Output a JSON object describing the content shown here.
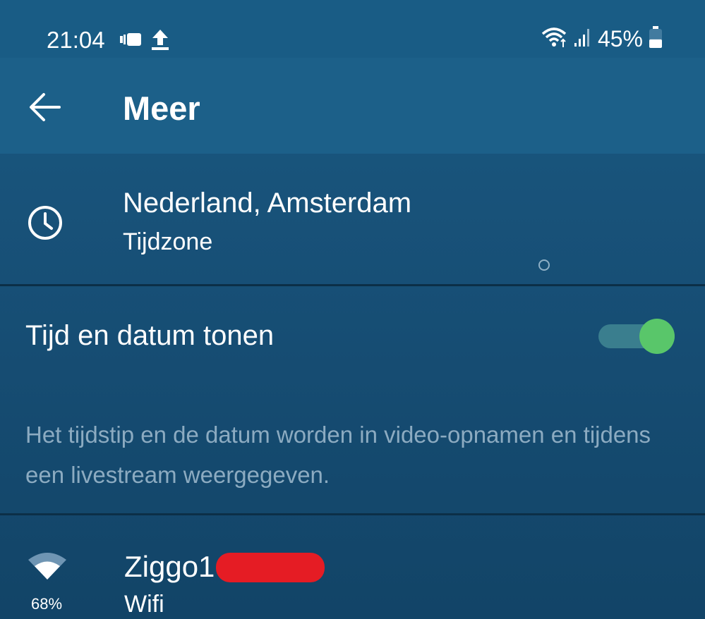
{
  "status_bar": {
    "time": "21:04",
    "battery_percent": "45%",
    "battery_level": 0.45,
    "icons": [
      "message-icon",
      "upload-icon",
      "wifi-status-icon",
      "signal-icon",
      "battery-icon"
    ]
  },
  "app_bar": {
    "title": "Meer",
    "back_icon": "arrow-left-icon"
  },
  "timezone": {
    "value": "Nederland, Amsterdam",
    "label": "Tijdzone",
    "icon": "clock-icon"
  },
  "show_time_date": {
    "label": "Tijd en datum tonen",
    "enabled": true,
    "description": "Het tijdstip en de datum worden in video-opnamen en tijdens een livestream weergegeven."
  },
  "wifi": {
    "network_name": "Ziggo1",
    "label": "Wifi",
    "signal": "68%",
    "icon": "wifi-icon",
    "redaction_color": "#e51c24"
  },
  "colors": {
    "accent_green": "#59c66a",
    "background": "#174f76",
    "muted_text": "#8cabc1"
  }
}
